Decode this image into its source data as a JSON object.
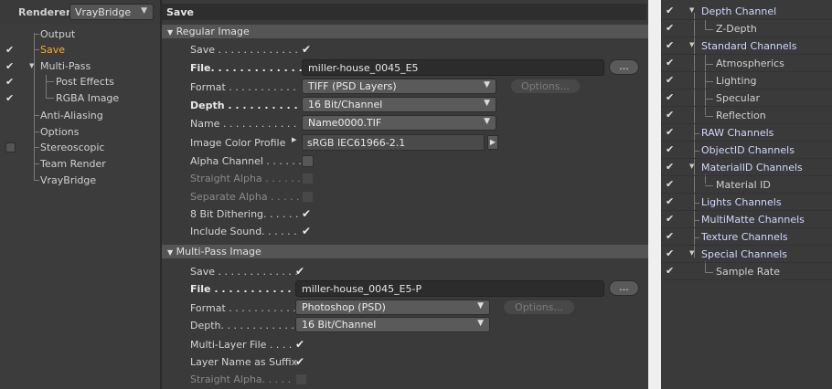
{
  "renderer": {
    "label": "Renderer",
    "value": "VrayBridge"
  },
  "left_tree": [
    {
      "label": "Output",
      "checkbox": "none",
      "indent": 1,
      "active": false
    },
    {
      "label": "Save",
      "checkbox": "checked",
      "indent": 1,
      "active": true
    },
    {
      "label": "Multi-Pass",
      "checkbox": "checked",
      "indent": 1,
      "active": false,
      "expandable": true
    },
    {
      "label": "Post Effects",
      "checkbox": "checked",
      "indent": 2,
      "active": false
    },
    {
      "label": "RGBA Image",
      "checkbox": "checked",
      "indent": 2,
      "active": false
    },
    {
      "label": "Anti-Aliasing",
      "checkbox": "none",
      "indent": 1,
      "active": false
    },
    {
      "label": "Options",
      "checkbox": "none",
      "indent": 1,
      "active": false
    },
    {
      "label": "Stereoscopic",
      "checkbox": "empty",
      "indent": 1,
      "active": false
    },
    {
      "label": "Team Render",
      "checkbox": "none",
      "indent": 1,
      "active": false
    },
    {
      "label": "VrayBridge",
      "checkbox": "none",
      "indent": 1,
      "active": false
    }
  ],
  "panel_title": "Save",
  "regular_image": {
    "heading": "Regular Image",
    "save_label": "Save . . . . . . . . . . . . .",
    "save_checked": true,
    "file_label": "File. . . . . . . . . . . . . .",
    "file_value": "miller-house_0045_E5",
    "browse_label": "...",
    "format_label": "Format . . . . . . . . . . .",
    "format_value": "TIFF (PSD Layers)",
    "options_label": "Options...",
    "depth_label": "Depth . . . . . . . . . . . .",
    "depth_value": "16 Bit/Channel",
    "name_label": "Name . . . . . . . . . . . .",
    "name_value": "Name0000.TIF",
    "profile_label": "Image Color Profile",
    "profile_value": "sRGB IEC61966-2.1",
    "alpha_label": "Alpha Channel . . . . . .",
    "straight_alpha_label": "Straight Alpha . . . . . .",
    "separate_alpha_label": "Separate Alpha . . . . .",
    "dithering_label": "8 Bit Dithering. . . . . .",
    "sound_label": "Include Sound. . . . . .",
    "alpha_checked": false,
    "dithering_checked": true,
    "sound_checked": true
  },
  "multipass_image": {
    "heading": "Multi-Pass Image",
    "save_label": "Save . . . . . . . . . . . . .",
    "save_checked": true,
    "file_label": "File . . . . . . . . . . . . .",
    "file_value": "miller-house_0045_E5-P",
    "browse_label": "...",
    "format_label": "Format . . . . . . . . . . .",
    "format_value": "Photoshop (PSD)",
    "options_label": "Options...",
    "depth_label": "Depth. . . . . . . . . . . .",
    "depth_value": "16 Bit/Channel",
    "multilayer_label": "Multi-Layer File . . . .",
    "layer_suffix_label": "Layer Name as Suffix",
    "straight_alpha_label": "Straight Alpha. . . . .",
    "multilayer_checked": true,
    "layer_suffix_checked": true
  },
  "channels": [
    {
      "label": "Depth Channel",
      "type": "group",
      "expandable": true
    },
    {
      "label": "Z-Depth",
      "type": "child"
    },
    {
      "label": "Standard Channels",
      "type": "group",
      "expandable": true
    },
    {
      "label": "Atmospherics",
      "type": "child"
    },
    {
      "label": "Lighting",
      "type": "child"
    },
    {
      "label": "Specular",
      "type": "child"
    },
    {
      "label": "Reflection",
      "type": "child"
    },
    {
      "label": "RAW Channels",
      "type": "group",
      "expandable": false
    },
    {
      "label": "ObjectID Channels",
      "type": "group",
      "expandable": false
    },
    {
      "label": "MaterialID Channels",
      "type": "group",
      "expandable": true
    },
    {
      "label": "Material ID",
      "type": "child"
    },
    {
      "label": "Lights Channels",
      "type": "group",
      "expandable": false
    },
    {
      "label": "MultiMatte Channels",
      "type": "group",
      "expandable": false
    },
    {
      "label": "Texture Channels",
      "type": "group",
      "expandable": false
    },
    {
      "label": "Special Channels",
      "type": "group",
      "expandable": true
    },
    {
      "label": "Sample Rate",
      "type": "child"
    }
  ],
  "colors": {
    "active_item": "#ffaa22",
    "group_label": "#cfd8ff",
    "background": "#3a3a3a"
  }
}
